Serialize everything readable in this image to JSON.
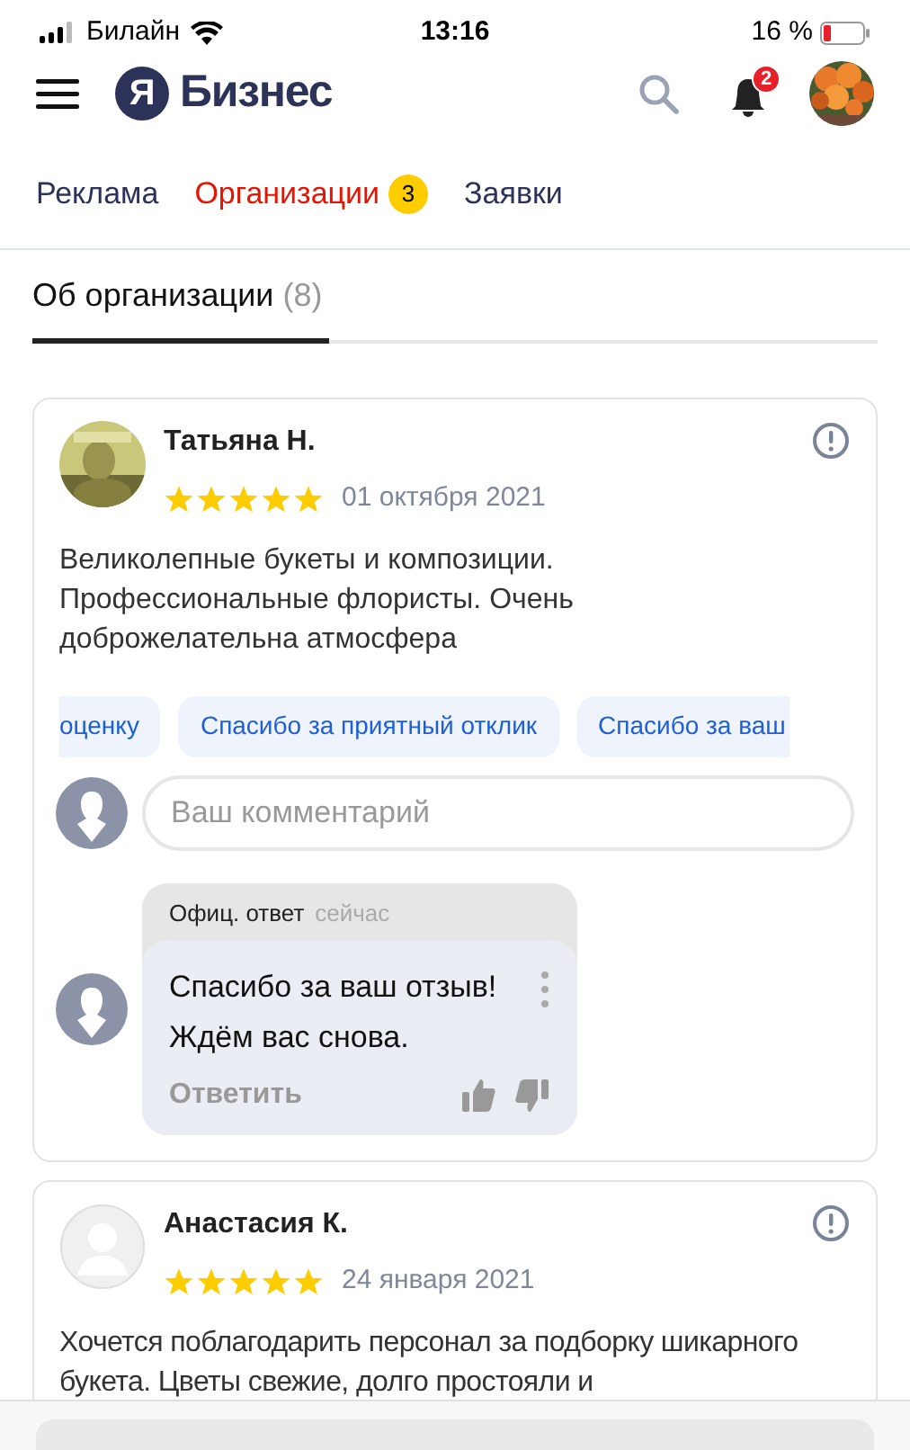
{
  "status_bar": {
    "carrier": "Билайн",
    "time": "13:16",
    "battery": "16 %"
  },
  "header": {
    "logo_mark": "Я",
    "logo_text": "Бизнес",
    "notifications": "2"
  },
  "tabs": [
    {
      "label": "Реклама",
      "selected": false
    },
    {
      "label": "Организации",
      "badge": "3",
      "selected": true
    },
    {
      "label": "Заявки",
      "selected": false
    }
  ],
  "section_tabs": [
    {
      "label": "Об организации",
      "count": "(8)",
      "selected": true
    }
  ],
  "reviews": [
    {
      "author": "Татьяна Н.",
      "stars": 5,
      "date": "01 октября 2021",
      "text": "Великолепные букеты и композиции. Профессиональные флористы. Очень доброжелательна атмосфера",
      "quick_replies": [
        "оценку",
        "Спасибо за приятный отклик",
        "Спасибо за ваш"
      ],
      "comment_placeholder": "Ваш комментарий",
      "reply": {
        "label": "Офиц. ответ",
        "time": "сейчас",
        "text": "Спасибо за ваш отзыв! Ждём вас снова.",
        "action": "Ответить"
      }
    },
    {
      "author": "Анастасия К.",
      "avatar": {
        "kind": "generic"
      },
      "stars": 5,
      "date": "24 января 2021",
      "text": "Хочется поблагодарить персонал за подборку шикарного букета. Цветы свежие, долго простояли и"
    }
  ]
}
